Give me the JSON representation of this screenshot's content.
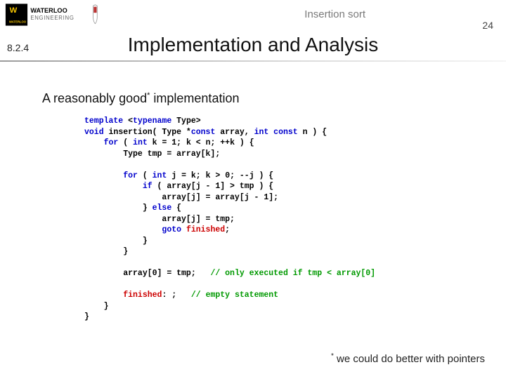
{
  "header": {
    "topic": "Insertion sort",
    "page_number": "24",
    "section_number": "8.2.4"
  },
  "title": "Implementation and Analysis",
  "lead": {
    "prefix": "A reasonably good",
    "star": "*",
    "suffix": " implementation"
  },
  "code": {
    "l1a": "template",
    "l1b": " <",
    "l1c": "typename",
    "l1d": " Type>",
    "l2a": "void",
    "l2b": " insertion( Type *",
    "l2c": "const",
    "l2d": " array, ",
    "l2e": "int const",
    "l2f": " n ) {",
    "l3a": "    ",
    "l3b": "for",
    "l3c": " ( ",
    "l3d": "int",
    "l3e": " k = 1; k < n; ++k ) {",
    "l4": "        Type tmp = array[k];",
    "blank": "",
    "l5a": "        ",
    "l5b": "for",
    "l5c": " ( ",
    "l5d": "int",
    "l5e": " j = k; k > 0; --j ) {",
    "l6a": "            ",
    "l6b": "if",
    "l6c": " ( array[j - 1] > tmp ) {",
    "l7": "                array[j] = array[j - 1];",
    "l8a": "            } ",
    "l8b": "else",
    "l8c": " {",
    "l9": "                array[j] = tmp;",
    "l10a": "                ",
    "l10b": "goto",
    "l10c": " ",
    "l10d": "finished",
    "l10e": ";",
    "l11": "            }",
    "l12": "        }",
    "l13a": "        array[0] = tmp;   ",
    "l13b": "// only executed if tmp < array[0]",
    "l14a": "        ",
    "l14b": "finished",
    "l14c": ": ;   ",
    "l14d": "// empty statement",
    "l15": "    }",
    "l16": "}"
  },
  "footnote": {
    "star": "*",
    "text": " we could do better with pointers"
  }
}
